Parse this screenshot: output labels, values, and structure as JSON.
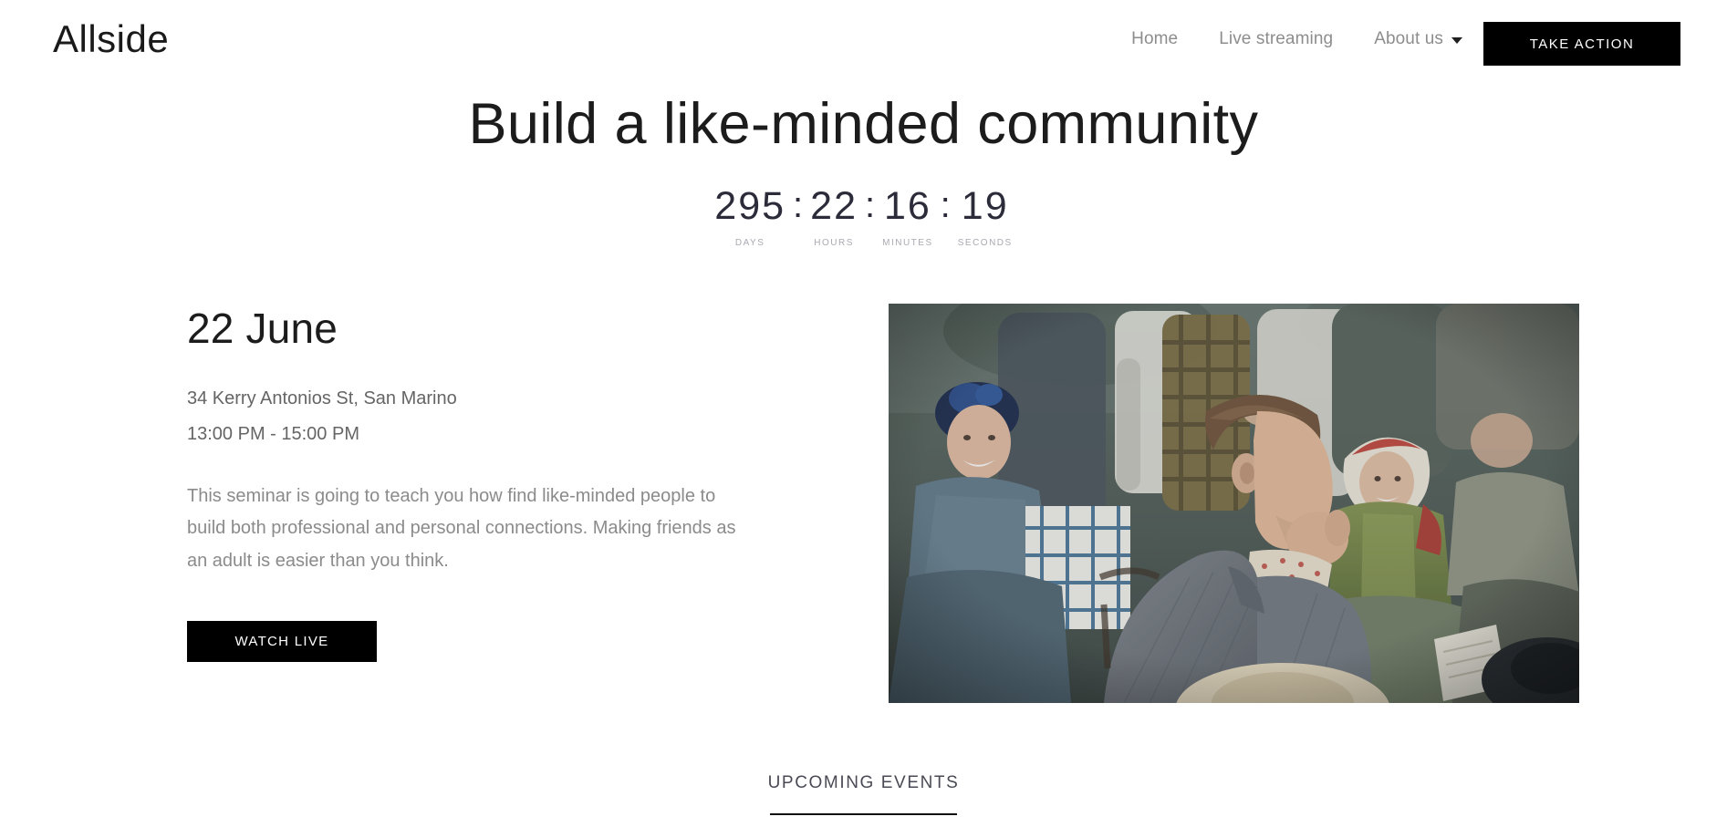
{
  "brand": {
    "logo": "Allside"
  },
  "nav": {
    "items": [
      {
        "label": "Home"
      },
      {
        "label": "Live streaming"
      },
      {
        "label": "About us",
        "has_dropdown": true
      }
    ],
    "cta_label": "TAKE ACTION"
  },
  "hero": {
    "title": "Build a like-minded community"
  },
  "countdown": {
    "separator": ":",
    "units": [
      {
        "value": "295",
        "label": "DAYS"
      },
      {
        "value": "22",
        "label": "HOURS"
      },
      {
        "value": "16",
        "label": "MINUTES"
      },
      {
        "value": "19",
        "label": "SECONDS"
      }
    ]
  },
  "event": {
    "date": "22 June",
    "address": "34 Kerry Antonios St, San Marino",
    "time": "13:00 PM - 15:00 PM",
    "description": "This seminar is going to teach you how find like-minded people to build both professional and personal connections. Making friends as an adult is easier than you think.",
    "watch_button_label": "WATCH LIVE",
    "image_alt": "Audience in period clothing seated outdoors, smiling man in grey tweed coat in foreground"
  },
  "upcoming": {
    "label": "UPCOMING EVENTS"
  },
  "colors": {
    "background": "#ffffff",
    "button_bg": "#000000",
    "button_text": "#ffffff",
    "heading": "#1c1c1c",
    "nav_link": "#8d8d8d",
    "body_text": "#8b8b8b",
    "meta_text": "#656565",
    "countdown_value": "#2b2b3a",
    "countdown_label": "#a9a9b2"
  }
}
